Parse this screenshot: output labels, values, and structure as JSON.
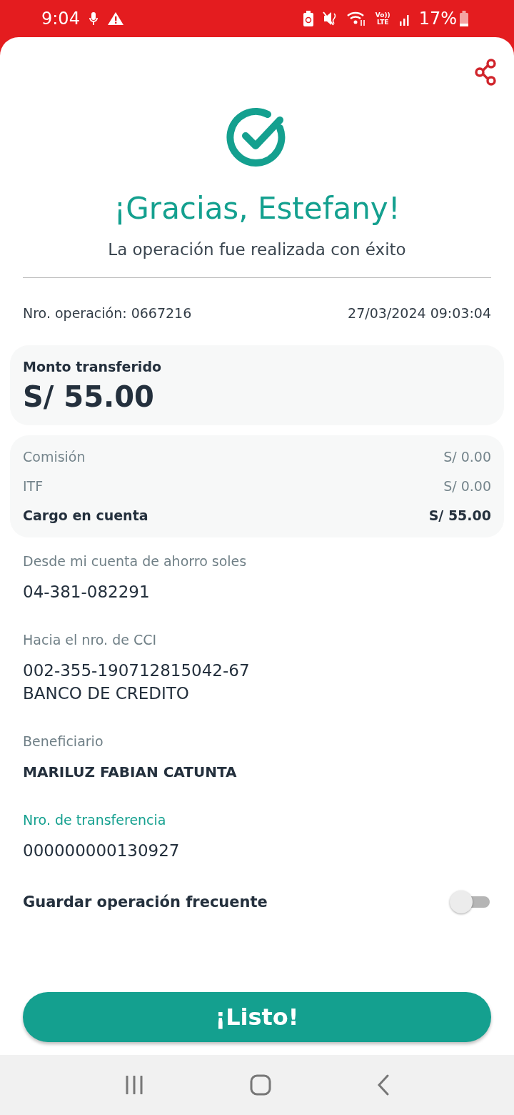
{
  "status_bar": {
    "time": "9:04",
    "volte": [
      "Vo))",
      "LTE"
    ],
    "battery": "17%"
  },
  "header": {
    "title": "¡Gracias, Estefany!",
    "subtitle": "La operación fue realizada con éxito"
  },
  "operation": {
    "number": "Nro. operación: 0667216",
    "datetime": "27/03/2024 09:03:04"
  },
  "amount_card": {
    "label": "Monto transferido",
    "amount": "S/ 55.00"
  },
  "charges": [
    {
      "label": "Comisión",
      "value": "S/ 0.00",
      "bold": false
    },
    {
      "label": "ITF",
      "value": "S/ 0.00",
      "bold": false
    },
    {
      "label": "Cargo en cuenta",
      "value": "S/ 55.00",
      "bold": true
    }
  ],
  "details": [
    {
      "label": "Desde mi cuenta de ahorro soles",
      "value_lines": [
        "04-381-082291"
      ],
      "label_accent": false,
      "value_bold": false
    },
    {
      "label": "Hacia el nro. de CCI",
      "value_lines": [
        "002-355-190712815042-67",
        "BANCO DE CREDITO"
      ],
      "label_accent": false,
      "value_bold": false
    },
    {
      "label": "Beneficiario",
      "value_lines": [
        "MARILUZ FABIAN CATUNTA"
      ],
      "label_accent": false,
      "value_bold": true
    },
    {
      "label": "Nro. de transferencia",
      "value_lines": [
        "000000000130927"
      ],
      "label_accent": true,
      "value_bold": false
    }
  ],
  "frequent_toggle": {
    "label": "Guardar operación frecuente",
    "on": false
  },
  "done_button": {
    "label": "¡Listo!"
  }
}
